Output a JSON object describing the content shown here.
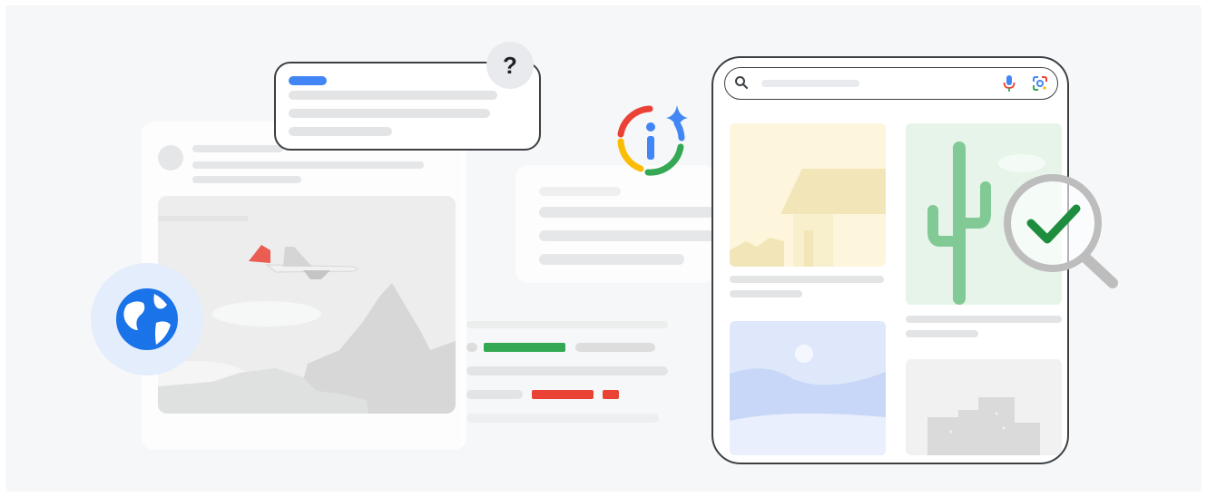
{
  "question_badge": {
    "text": "?"
  },
  "icons": {
    "info_icon": "info-i-sparkle-icon",
    "globe_icon": "globe-icon",
    "question_icon": "question-mark-icon",
    "search_icon": "search-icon",
    "mic_icon": "microphone-icon",
    "lens_icon": "camera-lens-icon",
    "check_icon": "checkmark-magnifier-icon"
  },
  "colors": {
    "google_blue": "#4285f4",
    "google_red": "#ea4335",
    "google_yellow": "#fbbc04",
    "google_green": "#34a853",
    "outline": "#3c4043",
    "background": "#f6f7f9"
  }
}
